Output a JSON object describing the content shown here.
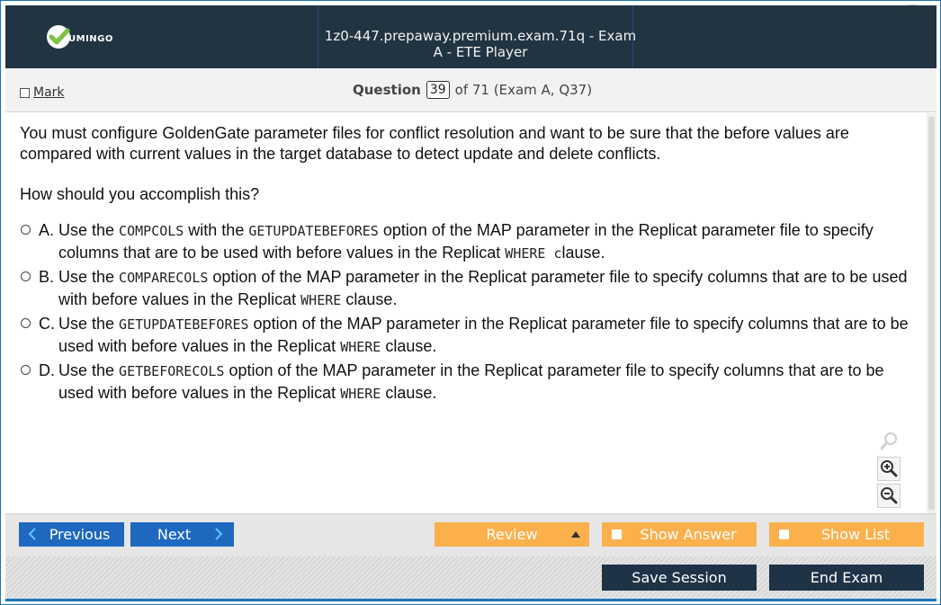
{
  "window": {
    "title": "1z0-447.prepaway.premium.exam.71q - Exam A - ETE Player",
    "logo_text": "UMINGO",
    "controls": {
      "minimize": "_",
      "maximize": "□",
      "close": "✕"
    }
  },
  "status": {
    "mark_label": "Mark",
    "question_label": "Question",
    "question_number": "39",
    "question_suffix": "of 71 (Exam A, Q37)"
  },
  "question": {
    "text": "You must configure GoldenGate parameter files for conflict resolution and want to be sure that the before values are compared with current values in the target database to detect update and delete conflicts.",
    "prompt": "How should you accomplish this?",
    "options": [
      {
        "letter": "A.",
        "p1": "Use the ",
        "c1": "COMPCOLS",
        "p2": " with the ",
        "c2": "GETUPDATEBEFORES",
        "p3": " option of the MAP parameter in the Replicat parameter file to specify columns that are to be used with before values in the Replicat ",
        "c3": "WHERE c",
        "p4": "lause."
      },
      {
        "letter": "B.",
        "p1": "Use the ",
        "c1": "COMPARECOLS",
        "p2": " option of the MAP parameter in the Replicat parameter file to specify columns that are to be used with before values in the Replicat ",
        "c2": "WHERE",
        "p3": " clause."
      },
      {
        "letter": "C.",
        "p1": "Use the ",
        "c1": "GETUPDATEBEFORES",
        "p2": " option of the MAP parameter in the Replicat parameter file to specify columns that are to be used with before values in the Replicat ",
        "c2": "WHERE",
        "p3": " clause."
      },
      {
        "letter": "D.",
        "p1": "Use the ",
        "c1": "GETBEFORECOLS",
        "p2": " option of the MAP parameter in the Replicat parameter file to specify columns that are to be used with before values in the Replicat ",
        "c2": "WHERE",
        "p3": " clause."
      }
    ]
  },
  "zoom": {
    "icons": [
      "search-icon",
      "zoom-in-icon",
      "zoom-out-icon"
    ]
  },
  "nav": {
    "previous": "Previous",
    "next": "Next",
    "review": "Review",
    "show_answer": "Show Answer",
    "show_list": "Show List",
    "save_session": "Save Session",
    "end_exam": "End Exam"
  },
  "colors": {
    "titlebar": "#213442",
    "accent_blue": "#1e68c0",
    "accent_orange": "#fbb04c",
    "dark_button": "#1e3346",
    "logo_green": "#7dc242"
  }
}
